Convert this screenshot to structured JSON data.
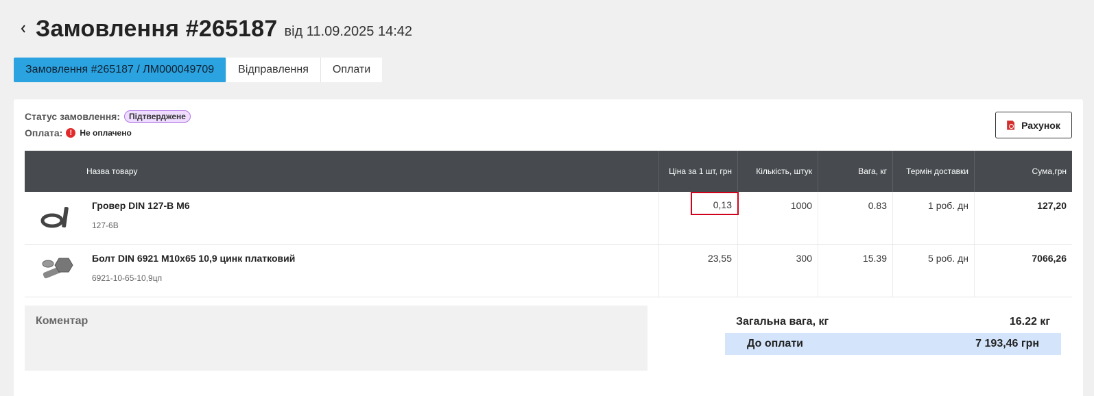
{
  "header": {
    "title": "Замовлення #265187",
    "date": "від 11.09.2025 14:42"
  },
  "tabs": [
    {
      "label": "Замовлення #265187 / ЛМ000049709",
      "active": true
    },
    {
      "label": "Відправлення",
      "active": false
    },
    {
      "label": "Оплати",
      "active": false
    }
  ],
  "status": {
    "order_label": "Статус замовлення:",
    "order_value": "Підтверджене",
    "payment_label": "Оплата:",
    "payment_value": "Не оплачено",
    "payment_icon": "alert-icon"
  },
  "invoice_button": {
    "label": "Рахунок",
    "icon": "pdf-icon"
  },
  "table": {
    "headers": {
      "name": "Назва товару",
      "price": "Ціна за 1 шт, грн",
      "qty": "Кількість, штук",
      "weight": "Вага, кг",
      "term": "Термін доставки",
      "sum": "Сума,грн"
    },
    "rows": [
      {
        "name": "Гровер DIN 127-B M6",
        "sku": "127-6B",
        "price": "0,13",
        "qty": "1000",
        "weight": "0.83",
        "term": "1 роб. дн",
        "sum": "127,20"
      },
      {
        "name": "Болт DIN 6921 M10х65 10,9 цинк платковий",
        "sku": "6921-10-65-10,9цп",
        "price": "23,55",
        "qty": "300",
        "weight": "15.39",
        "term": "5 роб. дн",
        "sum": "7066,26"
      }
    ]
  },
  "comment": {
    "label": "Коментар"
  },
  "totals": {
    "weight_label": "Загальна вага, кг",
    "weight_value": "16.22 кг",
    "pay_label": "До оплати",
    "pay_value": "7 193,46 грн"
  },
  "colors": {
    "accent": "#2aa3e0",
    "header_bg": "#474b4f",
    "highlight": "#d0021b",
    "pay_bg": "#d3e4fb",
    "badge_bg": "#efdcff"
  }
}
